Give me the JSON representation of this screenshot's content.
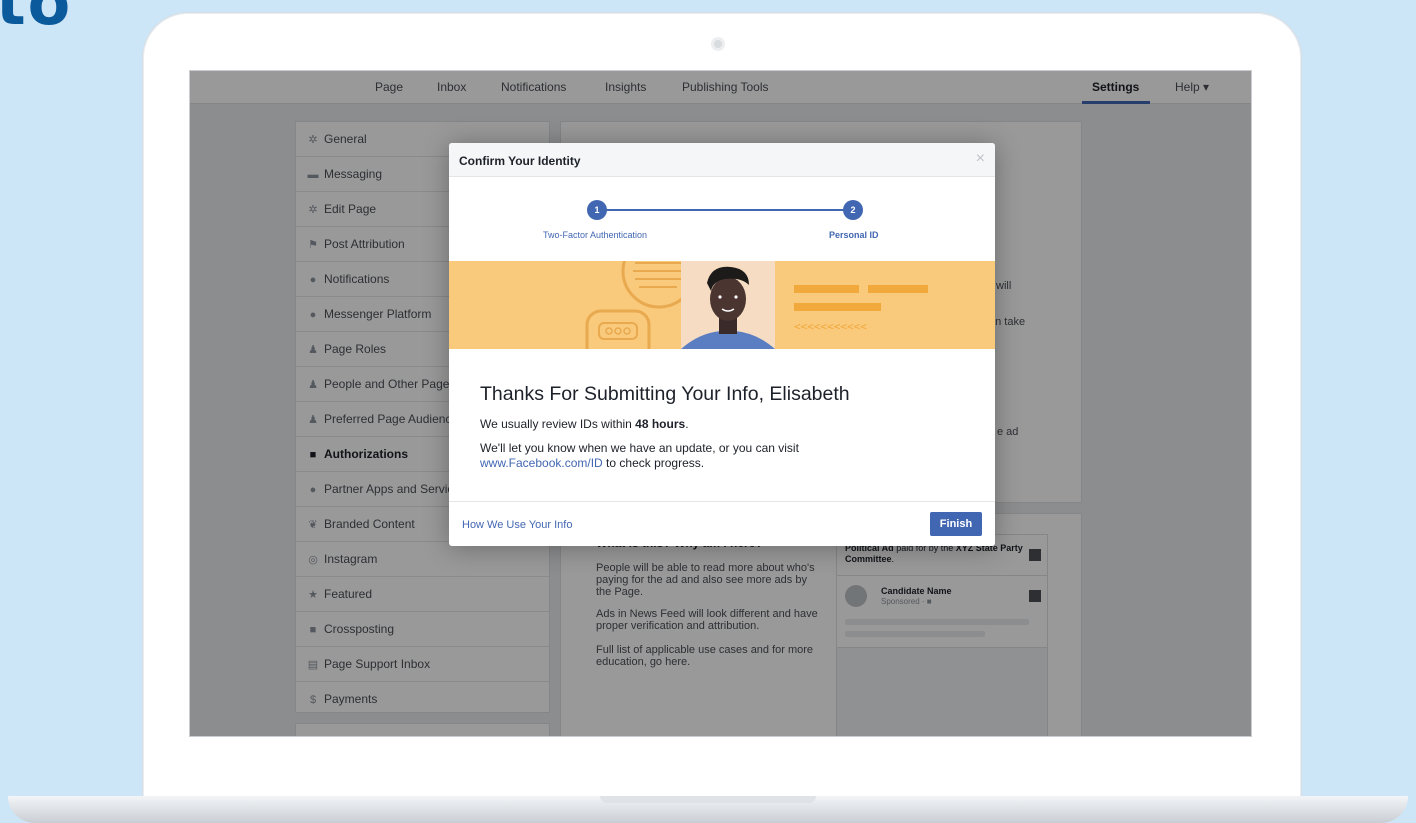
{
  "corner_text": "to",
  "topnav": {
    "items": [
      "Page",
      "Inbox",
      "Notifications",
      "Insights",
      "Publishing Tools"
    ],
    "settings": "Settings",
    "help": "Help ▾"
  },
  "sidebar": {
    "items": [
      {
        "label": "General",
        "icon": "gear-icon"
      },
      {
        "label": "Messaging",
        "icon": "messaging-icon"
      },
      {
        "label": "Edit Page",
        "icon": "gear-icon"
      },
      {
        "label": "Post Attribution",
        "icon": "flag-icon"
      },
      {
        "label": "Notifications",
        "icon": "globe-icon"
      },
      {
        "label": "Messenger Platform",
        "icon": "messenger-icon"
      },
      {
        "label": "Page Roles",
        "icon": "person-icon"
      },
      {
        "label": "People and Other Pages",
        "icon": "people-icon"
      },
      {
        "label": "Preferred Page Audience",
        "icon": "people-icon"
      },
      {
        "label": "Authorizations",
        "icon": "id-card-icon"
      },
      {
        "label": "Partner Apps and Services",
        "icon": "apps-icon"
      },
      {
        "label": "Branded Content",
        "icon": "handshake-icon"
      },
      {
        "label": "Instagram",
        "icon": "instagram-icon"
      },
      {
        "label": "Featured",
        "icon": "star-icon"
      },
      {
        "label": "Crossposting",
        "icon": "video-icon"
      },
      {
        "label": "Page Support Inbox",
        "icon": "inbox-icon"
      },
      {
        "label": "Payments",
        "icon": "dollar-icon"
      }
    ]
  },
  "background_content": {
    "snippets": [
      "will",
      "an take",
      "e ad"
    ],
    "lower_title": "What is this? Why am I here?",
    "paragraphs": [
      "People will be able to read more about who's paying for the ad and also see more ads by the Page.",
      "Ads in News Feed will look different and have proper verification and attribution.",
      "Full list of applicable use cases and for more education, go here."
    ],
    "ad_preview": {
      "header_prefix": "Political Ad",
      "header_middle": " paid for by the ",
      "header_org": "XYZ State Party Committee",
      "name": "Candidate Name",
      "sponsored": "Sponsored · ■"
    }
  },
  "modal": {
    "title": "Confirm Your Identity",
    "close": "×",
    "steps": [
      {
        "number": "1",
        "label": "Two-Factor Authentication"
      },
      {
        "number": "2",
        "label": "Personal ID"
      }
    ],
    "banner_chevrons": "<<<<<<<<<<<",
    "heading": "Thanks For Submitting Your Info, Elisabeth",
    "p1_pre": "We usually review IDs within ",
    "p1_bold": "48 hours",
    "p1_post": ".",
    "p2_pre": "We'll let you know when we have an update, or you can visit",
    "p2_link": "www.Facebook.com/ID",
    "p2_post": " to check progress.",
    "footer_link": "How We Use Your Info",
    "finish_label": "Finish"
  },
  "colors": {
    "facebook_blue": "#4267b2",
    "banner_yellow": "#f9c97c",
    "background": "#cde6f7"
  }
}
